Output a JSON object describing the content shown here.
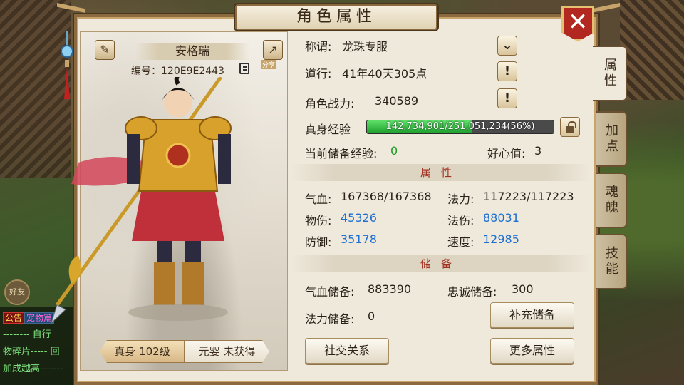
{
  "window": {
    "title": "角色属性"
  },
  "character": {
    "name": "安格瑞",
    "id_label": "编号：",
    "id_value": "120E9E2443",
    "share_label": "分享"
  },
  "level_tabs": [
    {
      "label": "真身 102级",
      "active": true
    },
    {
      "label": "元婴 未获得",
      "active": false
    }
  ],
  "info": {
    "title_label": "称谓:",
    "title_value": "龙珠专服",
    "daoxing_label": "道行:",
    "daoxing_value": "41年40天305点",
    "power_label": "角色战力:",
    "power_value": "340589",
    "exp_label": "真身经验",
    "exp_text": "142,734,901/251,051,234(56%)",
    "exp_percent": 56,
    "stored_exp_label": "当前储备经验:",
    "stored_exp_value": "0",
    "kindness_label": "好心值:",
    "kindness_value": "3"
  },
  "attributes": {
    "header": "属性",
    "hp_label": "气血:",
    "hp_value": "167368/167368",
    "mp_label": "法力:",
    "mp_value": "117223/117223",
    "phys_label": "物伤:",
    "phys_value": "45326",
    "mag_label": "法伤:",
    "mag_value": "88031",
    "def_label": "防御:",
    "def_value": "35178",
    "speed_label": "速度:",
    "speed_value": "12985"
  },
  "reserves": {
    "header": "储备",
    "hp_label": "气血储备:",
    "hp_value": "883390",
    "loyalty_label": "忠诚储备:",
    "loyalty_value": "300",
    "mp_label": "法力储备:",
    "mp_value": "0"
  },
  "buttons": {
    "replenish": "补充储备",
    "social": "社交关系",
    "more": "更多属性"
  },
  "side_tabs": [
    {
      "label": "属性",
      "active": true
    },
    {
      "label": "加点",
      "active": false
    },
    {
      "label": "魂魄",
      "active": false
    },
    {
      "label": "技能",
      "active": false
    }
  ],
  "chat": {
    "friend_label": "好友",
    "tag_notice": "公告",
    "tag_pet": "宠物篇",
    "line1": "-------- 自行",
    "line2": "物碎片----- 回",
    "line3": "加成越高-------"
  },
  "icons": {
    "edit": "pencil-icon",
    "share": "share-icon",
    "copy": "copy-icon",
    "close": "close-icon",
    "dropdown": "chevron-down-icon",
    "info": "exclamation-icon",
    "lock": "lock-icon"
  }
}
